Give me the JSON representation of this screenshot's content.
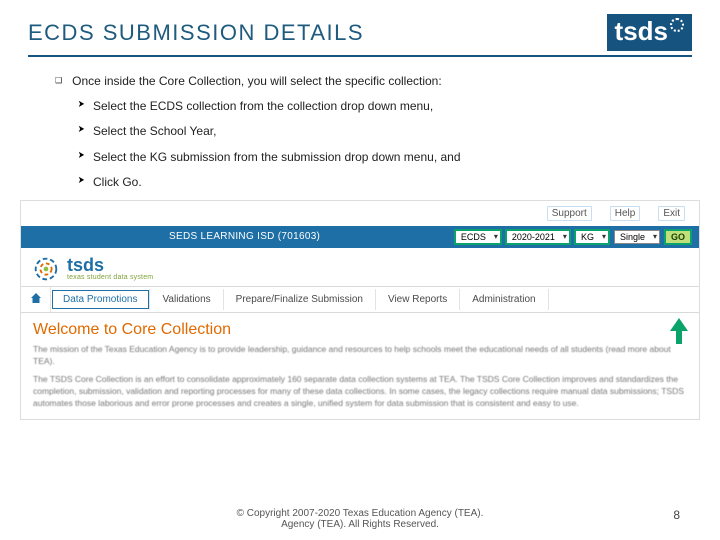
{
  "title": "ECDS SUBMISSION DETAILS",
  "intro": "Once inside the Core Collection, you will select the specific collection:",
  "steps": [
    "Select the ECDS collection from the collection drop down menu,",
    "Select the School Year,",
    "Select the KG submission from the submission drop down menu, and",
    "Click Go."
  ],
  "app": {
    "top_links": {
      "support": "Support",
      "help": "Help",
      "exit": "Exit"
    },
    "district": "SEDS LEARNING ISD (701603)",
    "selects": {
      "collection": "ECDS",
      "year": "2020-2021",
      "submission": "KG",
      "mode": "Single"
    },
    "go": "GO",
    "brand_main": "tsds",
    "brand_sub": "texas student\ndata system",
    "tabs": {
      "promotions": "Data Promotions",
      "validations": "Validations",
      "prepare": "Prepare/Finalize Submission",
      "reports": "View Reports",
      "admin": "Administration"
    },
    "welcome": "Welcome to Core Collection",
    "para1": "The mission of the Texas Education Agency is to provide leadership, guidance and resources to help schools meet the educational needs of all students (read more about TEA).",
    "para2": "The TSDS Core Collection is an effort to consolidate approximately 160 separate data collection systems at TEA. The TSDS Core Collection improves and standardizes the completion, submission, validation and reporting processes for many of these data collections. In some cases, the legacy collections require manual data submissions; TSDS automates those laborious and error prone processes and creates a single, unified system for data submission that is consistent and easy to use."
  },
  "copyright_line1": "© Copyright 2007-2020 Texas Education Agency (TEA).",
  "copyright_line2": "Agency (TEA). All Rights Reserved.",
  "page_number": "8"
}
